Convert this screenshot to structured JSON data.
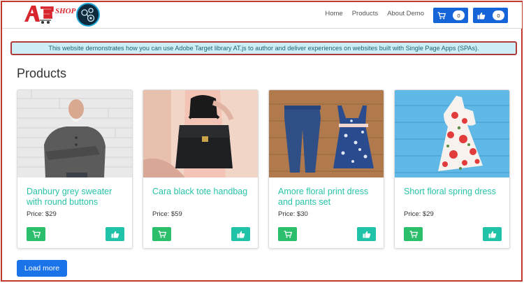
{
  "header": {
    "logo_text": "SHOP",
    "nav": [
      "Home",
      "Products",
      "About Demo"
    ],
    "cart_count": "0",
    "like_count": "0"
  },
  "banner": {
    "text": "This website demonstrates how you can use Adobe Target library AT.js to author and deliver experiences on websites built with Single Page Apps (SPAs)."
  },
  "page": {
    "title": "Products",
    "load_more": "Load more"
  },
  "products": [
    {
      "name": "Danbury grey sweater with round buttons",
      "price": "Price: $29"
    },
    {
      "name": "Cara black tote handbag",
      "price": "Price: $59"
    },
    {
      "name": "Amore floral print dress and pants set",
      "price": "Price: $30"
    },
    {
      "name": "Short floral spring dress",
      "price": "Price: $29"
    }
  ],
  "icons": {
    "cart": "shopping-cart-icon",
    "like": "thumbs-up-icon"
  },
  "colors": {
    "header_button": "#1565d8",
    "banner_bg": "#cdeef6",
    "product_title": "#27c3a8",
    "cart_button": "#2bbf6b",
    "like_button": "#20c3a8",
    "load_more": "#1a73e8",
    "frame": "#c0392b"
  }
}
